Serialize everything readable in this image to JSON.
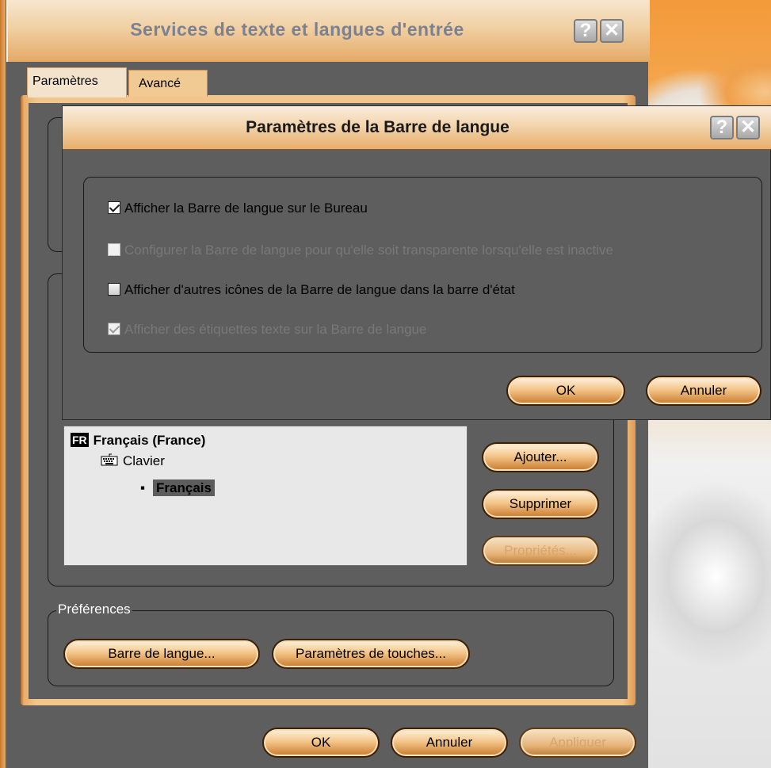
{
  "main_window": {
    "title": "Services de texte et langues d'entrée",
    "help_button": "?",
    "close_button": "✕",
    "tabs": [
      {
        "label": "Paramètres",
        "active": true
      },
      {
        "label": "Avancé",
        "active": false
      }
    ],
    "installed_services": {
      "language": {
        "badge": "FR",
        "name": "Français (France)"
      },
      "category": "Clavier",
      "item": "Français"
    },
    "service_buttons": {
      "add": "Ajouter...",
      "remove": "Supprimer",
      "properties": "Propriétés..."
    },
    "preferences": {
      "legend": "Préférences",
      "language_bar_button": "Barre de langue...",
      "key_settings_button": "Paramètres de touches..."
    },
    "footer": {
      "ok": "OK",
      "cancel": "Annuler",
      "apply": "Appliquer"
    }
  },
  "dialog": {
    "title": "Paramètres de la Barre de langue",
    "help_button": "?",
    "close_button": "✕",
    "options": [
      {
        "label": "Afficher la Barre de langue sur le Bureau",
        "checked": true,
        "enabled": true
      },
      {
        "label": "Configurer la Barre de langue pour qu'elle soit transparente lorsqu'elle est inactive",
        "checked": false,
        "enabled": false
      },
      {
        "label": "Afficher d'autres icônes de la Barre de langue dans la barre d'état",
        "checked": false,
        "enabled": true
      },
      {
        "label": "Afficher des étiquettes texte sur la Barre de langue",
        "checked": true,
        "enabled": false
      }
    ],
    "ok": "OK",
    "cancel": "Annuler"
  }
}
